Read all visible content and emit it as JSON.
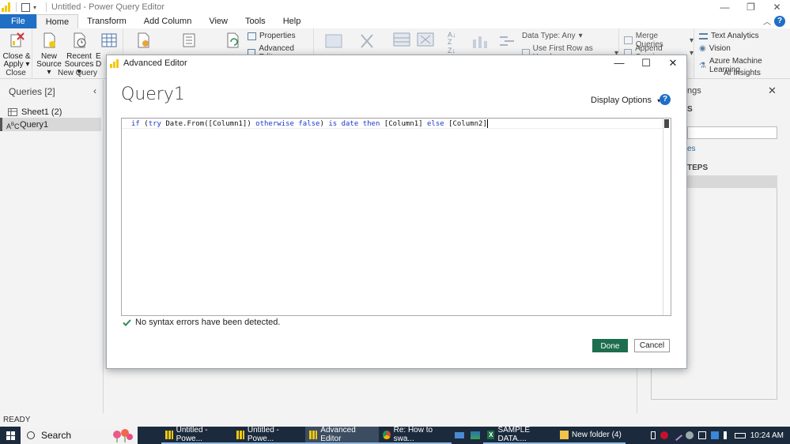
{
  "window": {
    "title": "Untitled - Power Query Editor",
    "minimize": "—",
    "restore": "❐",
    "close": "✕"
  },
  "ribbon_tabs": [
    "File",
    "Home",
    "Transform",
    "Add Column",
    "View",
    "Tools",
    "Help"
  ],
  "ribbon": {
    "close_apply": "Close &",
    "close_apply2": "Apply",
    "new_source": "New",
    "new_source2": "Source",
    "recent_sources": "Recent",
    "recent_sources2": "Sources",
    "enter_data_partial": "E",
    "enter_data_partial2": "D",
    "properties": "Properties",
    "advanced_editor": "Advanced Editor",
    "data_type": "Data Type: Any",
    "first_row_headers": "Use First Row as Headers",
    "merge_queries": "Merge Queries",
    "append_queries": "Append Queries",
    "text_analytics": "Text Analytics",
    "vision": "Vision",
    "azure_ml": "Azure Machine Learning",
    "group_close": "Close",
    "group_new_query": "New Query",
    "group_ai_insights": "AI Insights"
  },
  "queries_panel": {
    "header": "Queries [2]",
    "collapse": "‹",
    "items": [
      {
        "label": "Sheet1 (2)",
        "selected": false
      },
      {
        "label": "Query1",
        "selected": true
      }
    ]
  },
  "right_panel": {
    "close": "✕",
    "partial_ngs": "ngs",
    "partial_s": "S",
    "partial_es": "es",
    "partial_steps": "TEPS"
  },
  "status": "READY",
  "dialog": {
    "title": "Advanced Editor",
    "query_name": "Query1",
    "display_options": "Display Options",
    "help": "?",
    "code_tokens": [
      {
        "t": "if",
        "k": "kw"
      },
      {
        "t": " (",
        "k": "tx"
      },
      {
        "t": "try",
        "k": "kw"
      },
      {
        "t": " Date.From([Column1]) ",
        "k": "tx"
      },
      {
        "t": "otherwise",
        "k": "kw"
      },
      {
        "t": " ",
        "k": "tx"
      },
      {
        "t": "false",
        "k": "kw"
      },
      {
        "t": ") ",
        "k": "tx"
      },
      {
        "t": "is",
        "k": "kw"
      },
      {
        "t": " ",
        "k": "tx"
      },
      {
        "t": "date",
        "k": "kw"
      },
      {
        "t": " ",
        "k": "tx"
      },
      {
        "t": "then",
        "k": "kw"
      },
      {
        "t": " [Column1] ",
        "k": "tx"
      },
      {
        "t": "else",
        "k": "kw"
      },
      {
        "t": " [Column2]",
        "k": "tx"
      }
    ],
    "syntax_status": "No syntax errors have been detected.",
    "done": "Done",
    "cancel": "Cancel"
  },
  "taskbar": {
    "search": "Search",
    "apps": [
      {
        "label": "Untitled - Powe...",
        "active": false
      },
      {
        "label": "Untitled - Powe...",
        "active": false
      },
      {
        "label": "Advanced Editor",
        "active": true
      },
      {
        "label": "Re: How to swa...",
        "active": false
      },
      {
        "label": "SAMPLE DATA....",
        "active": false
      },
      {
        "label": "New folder (4)",
        "active": false
      }
    ],
    "time": "10:24 AM"
  },
  "colors": {
    "file_tab": "#1f6fc5",
    "done_button": "#1d6e4f",
    "keyword": "#1b39c9",
    "taskbar": "#1b2a3c",
    "pbi_yellow": "#f2c811"
  }
}
